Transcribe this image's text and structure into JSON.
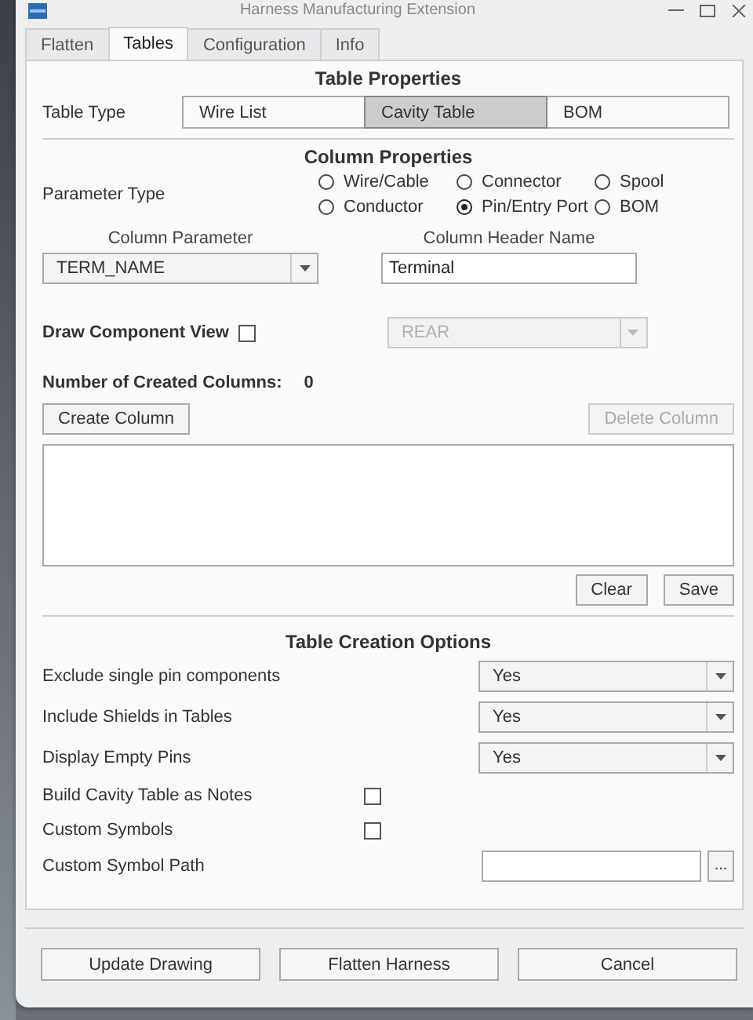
{
  "window": {
    "title": "Harness Manufacturing Extension"
  },
  "tabs": [
    {
      "label": "Flatten",
      "selected": false
    },
    {
      "label": "Tables",
      "selected": true
    },
    {
      "label": "Configuration",
      "selected": false
    },
    {
      "label": "Info",
      "selected": false
    }
  ],
  "table_properties": {
    "heading": "Table Properties",
    "label": "Table Type",
    "options": [
      {
        "label": "Wire List",
        "selected": false
      },
      {
        "label": "Cavity Table",
        "selected": true
      },
      {
        "label": "BOM",
        "selected": false
      }
    ]
  },
  "column_properties": {
    "heading": "Column Properties",
    "parameter_type_label": "Parameter Type",
    "radios": [
      {
        "label": "Wire/Cable",
        "selected": false
      },
      {
        "label": "Connector",
        "selected": false
      },
      {
        "label": "Spool",
        "selected": false
      },
      {
        "label": "Conductor",
        "selected": false
      },
      {
        "label": "Pin/Entry Port",
        "selected": true
      },
      {
        "label": "BOM",
        "selected": false
      }
    ],
    "column_parameter_label": "Column Parameter",
    "column_parameter_value": "TERM_NAME",
    "header_name_label": "Column Header Name",
    "header_name_value": "Terminal",
    "draw_view_label": "Draw Component View",
    "draw_view_checked": false,
    "view_value": "REAR",
    "view_disabled": true,
    "count_label": "Number of Created Columns:",
    "count_value": "0",
    "create_button": {
      "label": "Create Column",
      "disabled": false
    },
    "delete_button": {
      "label": "Delete Column",
      "disabled": true
    },
    "clear_button": "Clear",
    "save_button": "Save"
  },
  "creation_options": {
    "heading": "Table Creation Options",
    "rows": [
      {
        "kind": "dropdown",
        "label": "Exclude single pin components",
        "value": "Yes"
      },
      {
        "kind": "dropdown",
        "label": "Include Shields in Tables",
        "value": "Yes"
      },
      {
        "kind": "dropdown",
        "label": "Display Empty Pins",
        "value": "Yes"
      },
      {
        "kind": "checkbox",
        "label": "Build Cavity Table as Notes",
        "checked": false
      },
      {
        "kind": "checkbox",
        "label": "Custom Symbols",
        "checked": false
      },
      {
        "kind": "path",
        "label": "Custom Symbol Path",
        "browse": "..."
      }
    ]
  },
  "footer_buttons": [
    "Update Drawing",
    "Flatten Harness",
    "Cancel"
  ]
}
